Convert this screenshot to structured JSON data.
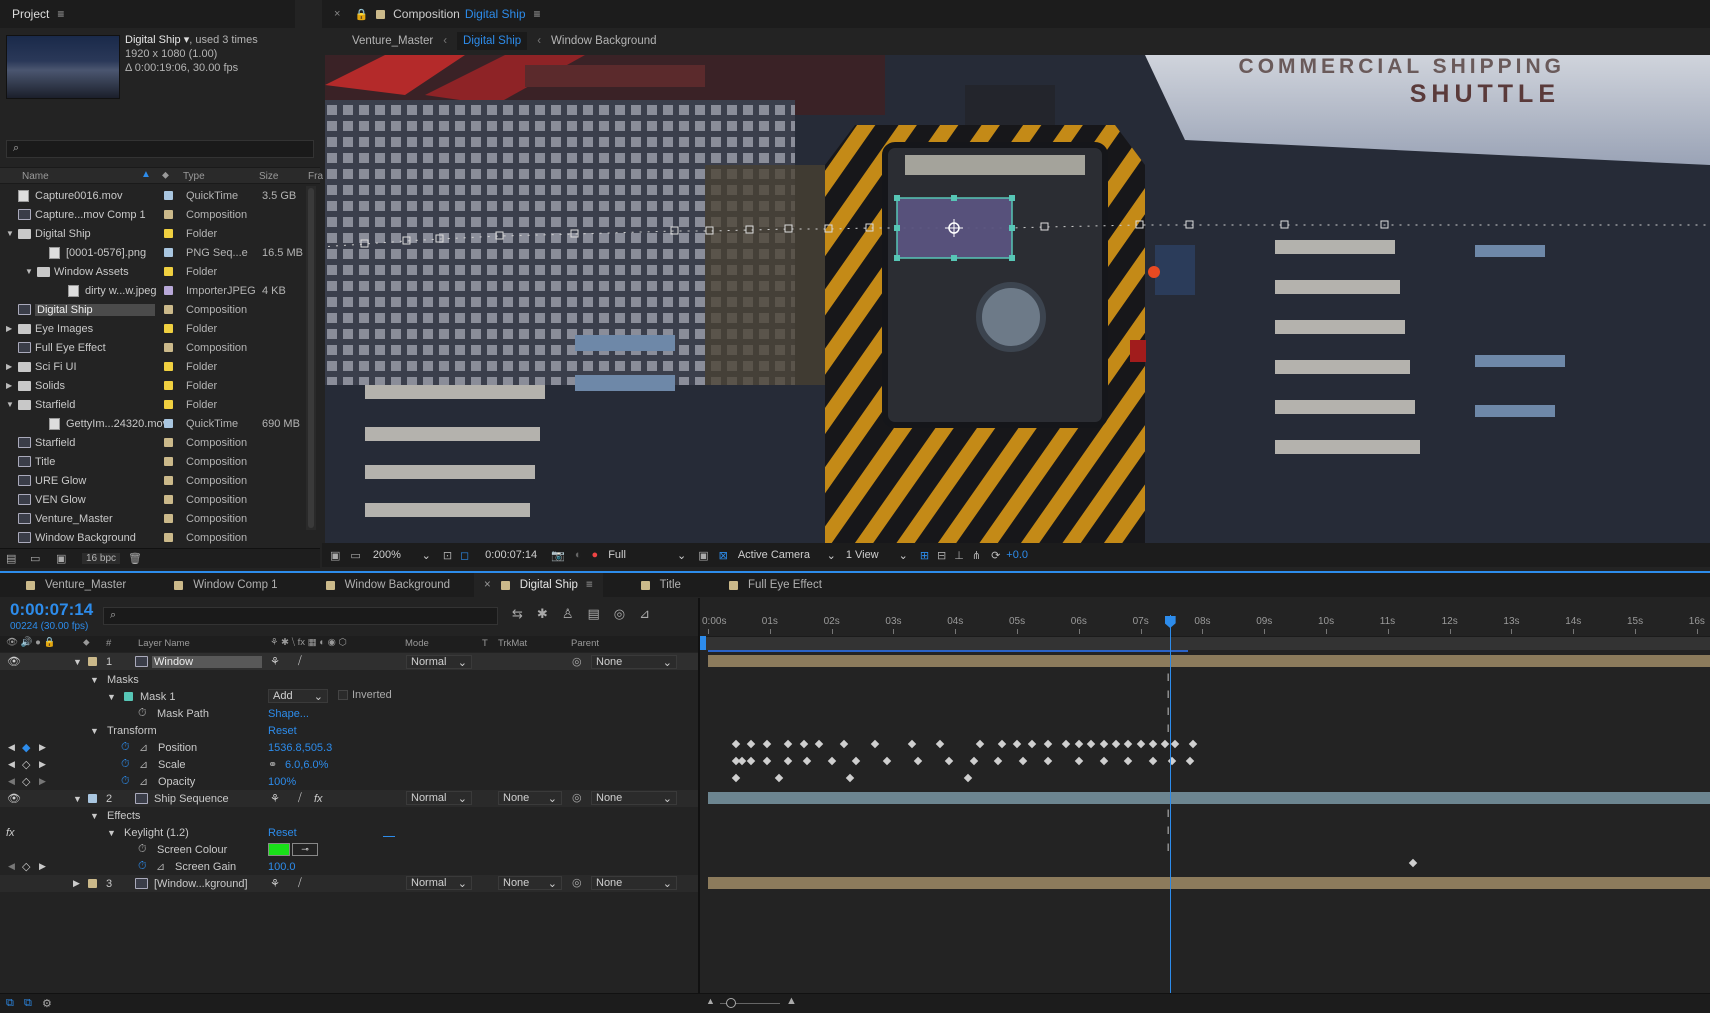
{
  "project": {
    "title": "Project",
    "item_name": "Digital Ship",
    "used": ", used 3 times",
    "dims": "1920 x 1080 (1.00)",
    "duration": "Δ 0:00:19:06, 30.00 fps",
    "search_placeholder": "",
    "columns": {
      "name": "Name",
      "type": "Type",
      "size": "Size",
      "fr": "Fra"
    },
    "items": [
      {
        "name": "Capture0016.mov",
        "type": "QuickTime",
        "size": "3.5 GB",
        "color": "#a9c6e0",
        "indent": 0,
        "kind": "footage"
      },
      {
        "name": "Capture...mov Comp 1",
        "type": "Composition",
        "size": "",
        "color": "#cbb98a",
        "indent": 0,
        "kind": "comp"
      },
      {
        "name": "Digital Ship",
        "type": "Folder",
        "size": "",
        "color": "#f0d040",
        "indent": 0,
        "kind": "folder",
        "tw": "open"
      },
      {
        "name": "[0001-0576].png",
        "type": "PNG Seq...e",
        "size": "16.5 MB",
        "color": "#a9c6e0",
        "indent": 1,
        "kind": "footage"
      },
      {
        "name": "Window Assets",
        "type": "Folder",
        "size": "",
        "color": "#f0d040",
        "indent": 1,
        "kind": "folder",
        "tw": "open"
      },
      {
        "name": "dirty w...w.jpeg",
        "type": "ImporterJPEG",
        "size": "4 KB",
        "color": "#b8a8d8",
        "indent": 2,
        "kind": "file"
      },
      {
        "name": "Digital Ship",
        "type": "Composition",
        "size": "",
        "color": "#cbb98a",
        "indent": 0,
        "kind": "comp",
        "selected": true
      },
      {
        "name": "Eye Images",
        "type": "Folder",
        "size": "",
        "color": "#f0d040",
        "indent": 0,
        "kind": "folder",
        "tw": "closed"
      },
      {
        "name": "Full Eye Effect",
        "type": "Composition",
        "size": "",
        "color": "#cbb98a",
        "indent": 0,
        "kind": "comp"
      },
      {
        "name": "Sci Fi UI",
        "type": "Folder",
        "size": "",
        "color": "#f0d040",
        "indent": 0,
        "kind": "folder",
        "tw": "closed"
      },
      {
        "name": "Solids",
        "type": "Folder",
        "size": "",
        "color": "#f0d040",
        "indent": 0,
        "kind": "folder",
        "tw": "closed"
      },
      {
        "name": "Starfield",
        "type": "Folder",
        "size": "",
        "color": "#f0d040",
        "indent": 0,
        "kind": "folder",
        "tw": "open"
      },
      {
        "name": "GettyIm...24320.mov",
        "type": "QuickTime",
        "size": "690 MB",
        "color": "#a9c6e0",
        "indent": 1,
        "kind": "footage"
      },
      {
        "name": "Starfield",
        "type": "Composition",
        "size": "",
        "color": "#cbb98a",
        "indent": 0,
        "kind": "comp"
      },
      {
        "name": "Title",
        "type": "Composition",
        "size": "",
        "color": "#cbb98a",
        "indent": 0,
        "kind": "comp"
      },
      {
        "name": "URE Glow",
        "type": "Composition",
        "size": "",
        "color": "#cbb98a",
        "indent": 0,
        "kind": "comp"
      },
      {
        "name": "VEN Glow",
        "type": "Composition",
        "size": "",
        "color": "#cbb98a",
        "indent": 0,
        "kind": "comp"
      },
      {
        "name": "Venture_Master",
        "type": "Composition",
        "size": "",
        "color": "#cbb98a",
        "indent": 0,
        "kind": "comp"
      },
      {
        "name": "Window Background",
        "type": "Composition",
        "size": "",
        "color": "#cbb98a",
        "indent": 0,
        "kind": "comp"
      }
    ],
    "bpc": "16 bpc"
  },
  "composition": {
    "prefix": "Composition",
    "name": "Digital Ship",
    "breadcrumbs": [
      "Venture_Master",
      "Digital Ship",
      "Window Background"
    ],
    "viewer_text_1": "COMMERCIAL SHIPPING",
    "viewer_text_2": "SHUTTLE",
    "toolbar": {
      "zoom": "200%",
      "timecode": "0:00:07:14",
      "resolution": "Full",
      "camera": "Active Camera",
      "views": "1 View",
      "exposure": "+0.0"
    }
  },
  "timeline": {
    "tabs": [
      "Venture_Master",
      "Window Comp 1",
      "Window Background",
      "Digital Ship",
      "Title",
      "Full Eye Effect"
    ],
    "tab_colors": [
      "#cbb98a",
      "#cbb98a",
      "#cbb98a",
      "#cbb98a",
      "#cbb98a",
      "#cbb98a"
    ],
    "active_tab": 3,
    "current_time": "0:00:07:14",
    "frame_info": "00224 (30.00 fps)",
    "col_headers": {
      "layer_name": "Layer Name",
      "mode": "Mode",
      "t": "T",
      "trkmat": "TrkMat",
      "parent": "Parent",
      "num": "#"
    },
    "ruler": [
      "0:00s",
      "01s",
      "02s",
      "03s",
      "04s",
      "05s",
      "06s",
      "07s",
      "08s",
      "09s",
      "10s",
      "11s",
      "12s",
      "13s",
      "14s",
      "15s",
      "16s"
    ],
    "playhead_seconds": 7.47,
    "layers": {
      "l1": {
        "num": "1",
        "name": "Window",
        "mode": "Normal",
        "parent": "None"
      },
      "masks": "Masks",
      "mask1": {
        "name": "Mask 1",
        "mode": "Add",
        "inverted": "Inverted"
      },
      "mask_path": {
        "label": "Mask Path",
        "value": "Shape..."
      },
      "transform": {
        "label": "Transform",
        "reset": "Reset"
      },
      "position": {
        "label": "Position",
        "value": "1536.8,505.3"
      },
      "scale": {
        "label": "Scale",
        "value": "6.0,6.0%"
      },
      "opacity": {
        "label": "Opacity",
        "value": "100%"
      },
      "l2": {
        "num": "2",
        "name": "Ship Sequence",
        "mode": "Normal",
        "trkmat": "None",
        "parent": "None"
      },
      "effects": "Effects",
      "keylight": {
        "label": "Keylight (1.2)",
        "reset": "Reset",
        "fx": "fx"
      },
      "screen_colour": {
        "label": "Screen Colour",
        "color": "#19e019"
      },
      "screen_gain": {
        "label": "Screen Gain",
        "value": "100.0"
      },
      "l3": {
        "num": "3",
        "name": "[Window...kground]",
        "mode": "Normal",
        "trkmat": "None",
        "parent": "None"
      }
    },
    "keyframes": {
      "position": [
        0.45,
        0.7,
        0.95,
        1.3,
        1.55,
        1.8,
        2.2,
        2.7,
        3.3,
        3.75,
        4.4,
        4.75,
        5.0,
        5.25,
        5.5,
        5.8,
        6.0,
        6.2,
        6.4,
        6.6,
        6.8,
        7.0,
        7.2,
        7.4,
        7.55,
        7.85
      ],
      "scale": [
        0.45,
        0.55,
        0.7,
        0.95,
        1.3,
        1.6,
        2.0,
        2.4,
        2.9,
        3.4,
        3.9,
        4.3,
        4.7,
        5.1,
        5.5,
        6.0,
        6.4,
        6.8,
        7.2,
        7.5,
        7.8
      ],
      "opacity": [
        0.45,
        1.15,
        2.3,
        4.2
      ],
      "screen_gain": [
        11.4
      ]
    }
  }
}
